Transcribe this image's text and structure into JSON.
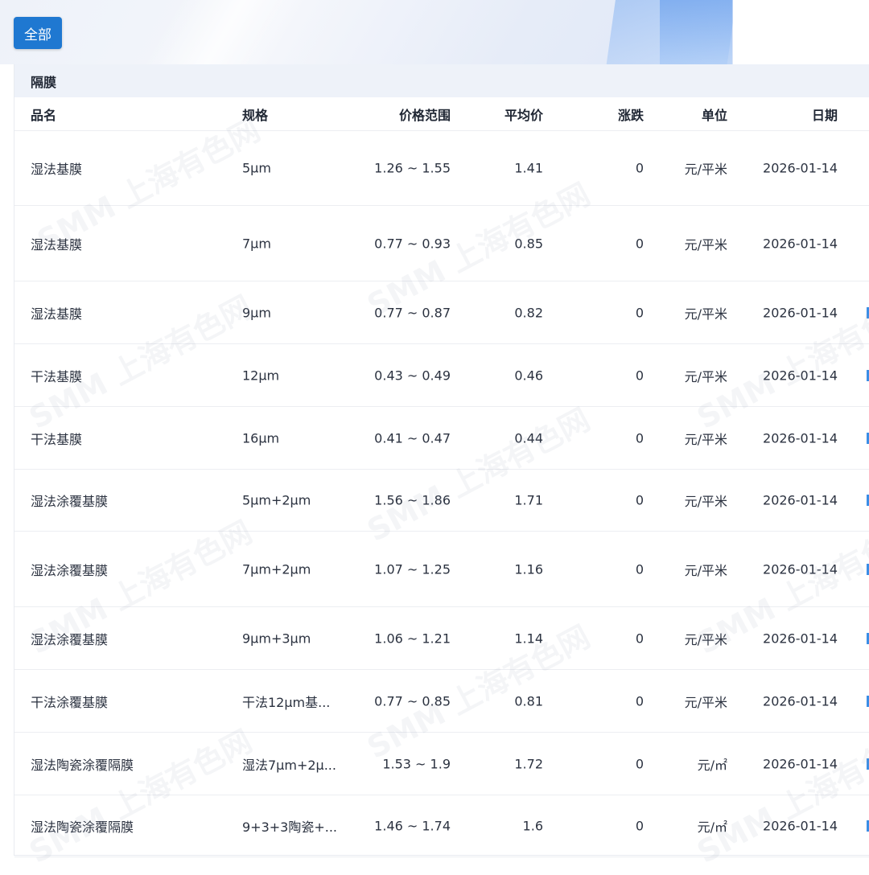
{
  "filter": {
    "all_label": "全部"
  },
  "section": {
    "title": "隔膜"
  },
  "table": {
    "headers": [
      "品名",
      "规格",
      "价格范围",
      "平均价",
      "涨跌",
      "单位",
      "日期"
    ],
    "rows": [
      [
        "湿法基膜",
        "5μm",
        "1.26 ~ 1.55",
        "1.41",
        "0",
        "元/平米",
        "2026-01-14"
      ],
      [
        "湿法基膜",
        "7μm",
        "0.77 ~ 0.93",
        "0.85",
        "0",
        "元/平米",
        "2026-01-14"
      ],
      [
        "湿法基膜",
        "9μm",
        "0.77 ~ 0.87",
        "0.82",
        "0",
        "元/平米",
        "2026-01-14"
      ],
      [
        "干法基膜",
        "12μm",
        "0.43 ~ 0.49",
        "0.46",
        "0",
        "元/平米",
        "2026-01-14"
      ],
      [
        "干法基膜",
        "16μm",
        "0.41 ~ 0.47",
        "0.44",
        "0",
        "元/平米",
        "2026-01-14"
      ],
      [
        "湿法涂覆基膜",
        "5μm+2μm",
        "1.56 ~ 1.86",
        "1.71",
        "0",
        "元/平米",
        "2026-01-14"
      ],
      [
        "湿法涂覆基膜",
        "7μm+2μm",
        "1.07 ~ 1.25",
        "1.16",
        "0",
        "元/平米",
        "2026-01-14"
      ],
      [
        "湿法涂覆基膜",
        "9μm+3μm",
        "1.06 ~ 1.21",
        "1.14",
        "0",
        "元/平米",
        "2026-01-14"
      ],
      [
        "干法涂覆基膜",
        "干法12μm基...",
        "0.77 ~ 0.85",
        "0.81",
        "0",
        "元/平米",
        "2026-01-14"
      ],
      [
        "湿法陶瓷涂覆隔膜",
        "湿法7μm+2μ...",
        "1.53 ~ 1.9",
        "1.72",
        "0",
        "元/㎡",
        "2026-01-14"
      ],
      [
        "湿法陶瓷涂覆隔膜",
        "9+3+3陶瓷+...",
        "1.46 ~ 1.74",
        "1.6",
        "0",
        "元/㎡",
        "2026-01-14"
      ]
    ]
  },
  "watermark": {
    "text": "SMM 上海有色网"
  },
  "colors": {
    "accent": "#1f78d1",
    "section_bg": "#eef2f9",
    "edge_mark": "#3a8ee6"
  }
}
